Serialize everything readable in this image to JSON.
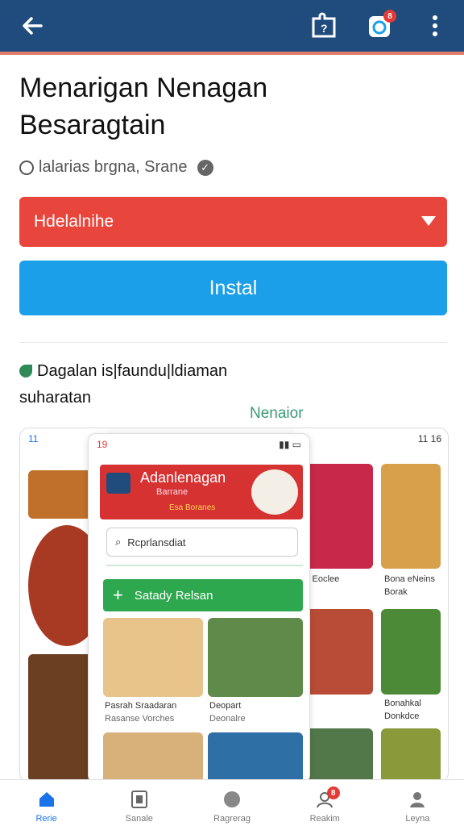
{
  "header": {
    "back_icon": "arrow-left-icon",
    "actions": [
      {
        "icon": "puzzle-help-icon"
      },
      {
        "icon": "notification-app-icon",
        "badge": "8"
      },
      {
        "icon": "more-vert-icon"
      }
    ]
  },
  "app": {
    "title_line1": "Menarigan Nenagan",
    "title_line2": "Besaragtain",
    "publisher": "lalarias brgna, Srane",
    "dropdown_label": "Hdelalnihe",
    "install_label": "Instal"
  },
  "description": {
    "line1": "Dagalan is|faundu|ldiaman",
    "line2": "suharatan",
    "new_label": "Nenaior"
  },
  "screenshots": {
    "left_status": "11",
    "center_status_time": "19",
    "center_header_title": "Adanlenagan",
    "center_header_sub": "Barrane",
    "center_header_tag": "Esa Boranes",
    "center_search_placeholder": "Rcprlansdiat",
    "center_button": "Satady Relsan",
    "center_caption1_title": "Pasrah Sraadaran",
    "center_caption1_sub": "Rasanse Vorches",
    "center_caption2_title": "Deopart",
    "center_caption2_sub": "Deonalre",
    "right_caption1": "s Eoclee",
    "right_caption2_title": "Bona eNeins",
    "right_caption2_sub": "Borak",
    "right_caption3_title": "Bonahkal",
    "right_caption3_sub": "Donkdce",
    "right_status": "11 16"
  },
  "bottom_nav": [
    {
      "label": "Rerie",
      "icon": "home-icon",
      "active": true
    },
    {
      "label": "Sanale",
      "icon": "apps-icon",
      "active": false
    },
    {
      "label": "Ragrerag",
      "icon": "games-icon",
      "active": false
    },
    {
      "label": "Reakim",
      "icon": "account-badge-icon",
      "active": false,
      "badge": "8"
    },
    {
      "label": "Leyna",
      "icon": "person-icon",
      "active": false
    }
  ],
  "colors": {
    "top_bar": "#1f4c7d",
    "dropdown": "#e8453c",
    "install": "#1a9fe8",
    "accent_green": "#2ea84f",
    "active_nav": "#1a73e8"
  }
}
